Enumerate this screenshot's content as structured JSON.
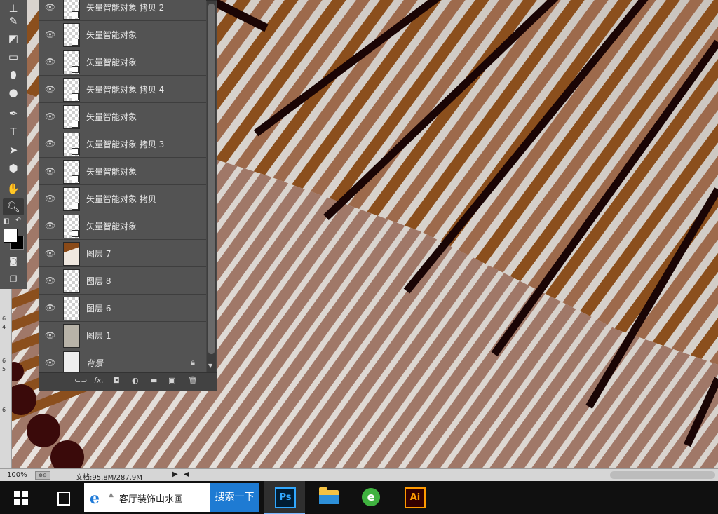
{
  "canvas": {
    "palette": {
      "brown": "#8b4f1d",
      "dark": "#1a0505",
      "cream": "#f4efea",
      "rose": "#a07868"
    }
  },
  "toolbar": {
    "tools": [
      "stamp-icon",
      "history-brush-icon",
      "eraser-icon",
      "gradient-icon",
      "blur-icon",
      "dodge-icon",
      "pen-icon",
      "type-icon",
      "path-select-icon",
      "shape-icon",
      "hand-icon",
      "zoom-icon"
    ],
    "type_glyph": "T",
    "zoom_active": true
  },
  "ruler": {
    "ticks": [
      "6",
      "4",
      "6",
      "5",
      "6"
    ]
  },
  "layers": {
    "rows": [
      {
        "name": "矢量智能对象 拷贝 2",
        "thumb": "smart"
      },
      {
        "name": "矢量智能对象",
        "thumb": "smart"
      },
      {
        "name": "矢量智能对象",
        "thumb": "smart"
      },
      {
        "name": "矢量智能对象 拷贝 4",
        "thumb": "smart"
      },
      {
        "name": "矢量智能对象",
        "thumb": "smart"
      },
      {
        "name": "矢量智能对象 拷贝 3",
        "thumb": "smart"
      },
      {
        "name": "矢量智能对象",
        "thumb": "smart"
      },
      {
        "name": "矢量智能对象 拷贝",
        "thumb": "smart"
      },
      {
        "name": "矢量智能对象",
        "thumb": "smart"
      },
      {
        "name": "图层 7",
        "thumb": "brown"
      },
      {
        "name": "图层 8",
        "thumb": "plain"
      },
      {
        "name": "图层 6",
        "thumb": "plain"
      },
      {
        "name": "图层 1",
        "thumb": "gray"
      },
      {
        "name": "背景",
        "thumb": "light",
        "locked": true
      }
    ],
    "footer_icons": [
      "link-icon",
      "fx-icon",
      "mask-icon",
      "adjustment-icon",
      "folder-icon",
      "new-layer-icon",
      "trash-icon"
    ],
    "fx_label": "fx."
  },
  "status": {
    "zoom": "100%",
    "doc": "文档:95.8M/287.9M"
  },
  "taskbar": {
    "search_text": "客厅装饰山水画",
    "search_button": "搜索一下",
    "ps_label": "Ps",
    "ai_label": "Ai"
  }
}
